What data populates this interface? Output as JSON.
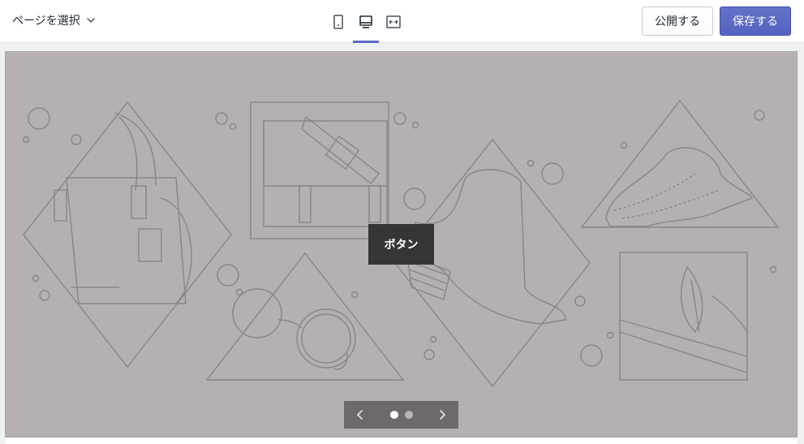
{
  "header": {
    "page_select_label": "ページを選択",
    "publish_label": "公開する",
    "save_label": "保存する",
    "devices": [
      {
        "icon": "mobile-icon",
        "active": false
      },
      {
        "icon": "desktop-icon",
        "active": true
      },
      {
        "icon": "full-width-icon",
        "active": false
      }
    ],
    "accent_color": "#5c6ac4"
  },
  "hero": {
    "button_label": "ボタン",
    "background_color": "#b6b0b0",
    "slide_count": 2,
    "active_slide": 1
  }
}
